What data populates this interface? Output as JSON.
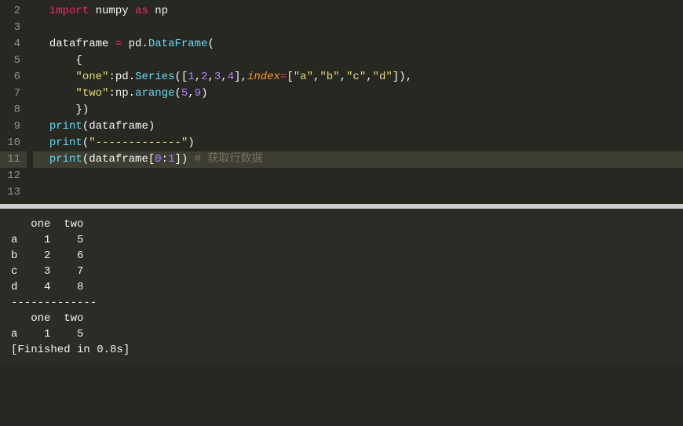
{
  "editor": {
    "gutter": [
      "2",
      "3",
      "4",
      "5",
      "6",
      "7",
      "8",
      "9",
      "10",
      "11",
      "12",
      "13"
    ],
    "highlighted_line": "11",
    "lines": {
      "l2": {
        "indent": "  ",
        "kw1": "import",
        "sp1": " ",
        "lib1": "numpy",
        "sp2": " ",
        "kw2": "as",
        "sp3": " ",
        "lib2": "np"
      },
      "l3": {
        "blank": ""
      },
      "l4": {
        "indent": "  ",
        "var": "dataframe",
        "sp1": " ",
        "op": "=",
        "sp2": " ",
        "obj": "pd",
        "dot": ".",
        "fn": "DataFrame",
        "paren": "("
      },
      "l5": {
        "indent": "      ",
        "brace": "{"
      },
      "l6": {
        "indent": "      ",
        "str1": "\"one\"",
        "colon": ":",
        "obj": "pd",
        "dot": ".",
        "fn": "Series",
        "paren1": "(",
        "bracket1": "[",
        "n1": "1",
        "c1": ",",
        "n2": "2",
        "c2": ",",
        "n3": "3",
        "c3": ",",
        "n4": "4",
        "bracket2": "]",
        "c4": ",",
        "param": "index",
        "eq": "=",
        "bracket3": "[",
        "s1": "\"a\"",
        "c5": ",",
        "s2": "\"b\"",
        "c6": ",",
        "s3": "\"c\"",
        "c7": ",",
        "s4": "\"d\"",
        "bracket4": "]",
        "paren2": ")",
        "c8": ","
      },
      "l7": {
        "indent": "      ",
        "str1": "\"two\"",
        "colon": ":",
        "obj": "np",
        "dot": ".",
        "fn": "arange",
        "paren1": "(",
        "n1": "5",
        "c1": ",",
        "n2": "9",
        "paren2": ")"
      },
      "l8": {
        "indent": "      ",
        "brace": "})"
      },
      "l9": {
        "indent": "  ",
        "fn": "print",
        "paren1": "(",
        "var": "dataframe",
        "paren2": ")"
      },
      "l10": {
        "indent": "  ",
        "fn": "print",
        "paren1": "(",
        "str": "\"-------------\"",
        "paren2": ")"
      },
      "l11": {
        "indent": "  ",
        "fn": "print",
        "paren1": "(",
        "var": "dataframe",
        "bracket1": "[",
        "n1": "0",
        "colon": ":",
        "n2": "1",
        "bracket2": "]",
        "paren2": ")",
        "sp": " ",
        "comment": "# 获取行数据"
      },
      "l12": {
        "blank": ""
      },
      "l13": {
        "blank": ""
      }
    }
  },
  "output": {
    "text": "   one  two\na    1    5\nb    2    6\nc    3    7\nd    4    8\n-------------\n   one  two\na    1    5\n[Finished in 0.8s]"
  }
}
